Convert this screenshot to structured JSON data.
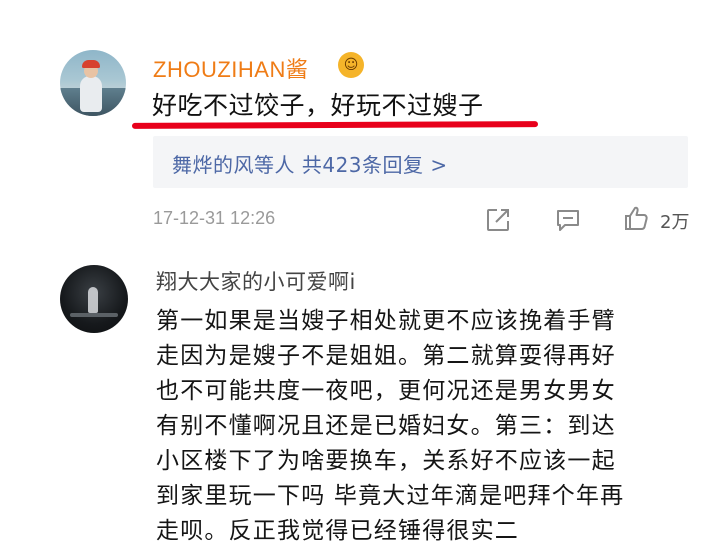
{
  "comments": [
    {
      "username": "ZHOUZIHAN酱",
      "badge_icon": "emoji-face-icon",
      "text": "好吃不过饺子，好玩不过嫂子",
      "replies_summary": "舞烨的风等人  共423条回复 >",
      "timestamp": "17-12-31 12:26",
      "like_count": "2万",
      "highlight_color": "#e8001b"
    },
    {
      "username": "翔大大家的小可爱啊i",
      "text_lines": [
        "第一如果是当嫂子相处就更不应该挽着手臂",
        "走因为是嫂子不是姐姐。第二就算耍得再好",
        "也不可能共度一夜吧，更何况还是男女男女",
        "有别不懂啊况且还是已婚妇女。第三：到达",
        "小区楼下了为啥要换车，关系好不应该一起",
        "到家里玩一下吗 毕竟大过年滴是吧拜个年再",
        "走呗。反正我觉得已经锤得很实二"
      ]
    }
  ],
  "colors": {
    "username_accent": "#ef7c16",
    "link_blue": "#4d68a6",
    "meta_gray": "#9a9a9a"
  }
}
